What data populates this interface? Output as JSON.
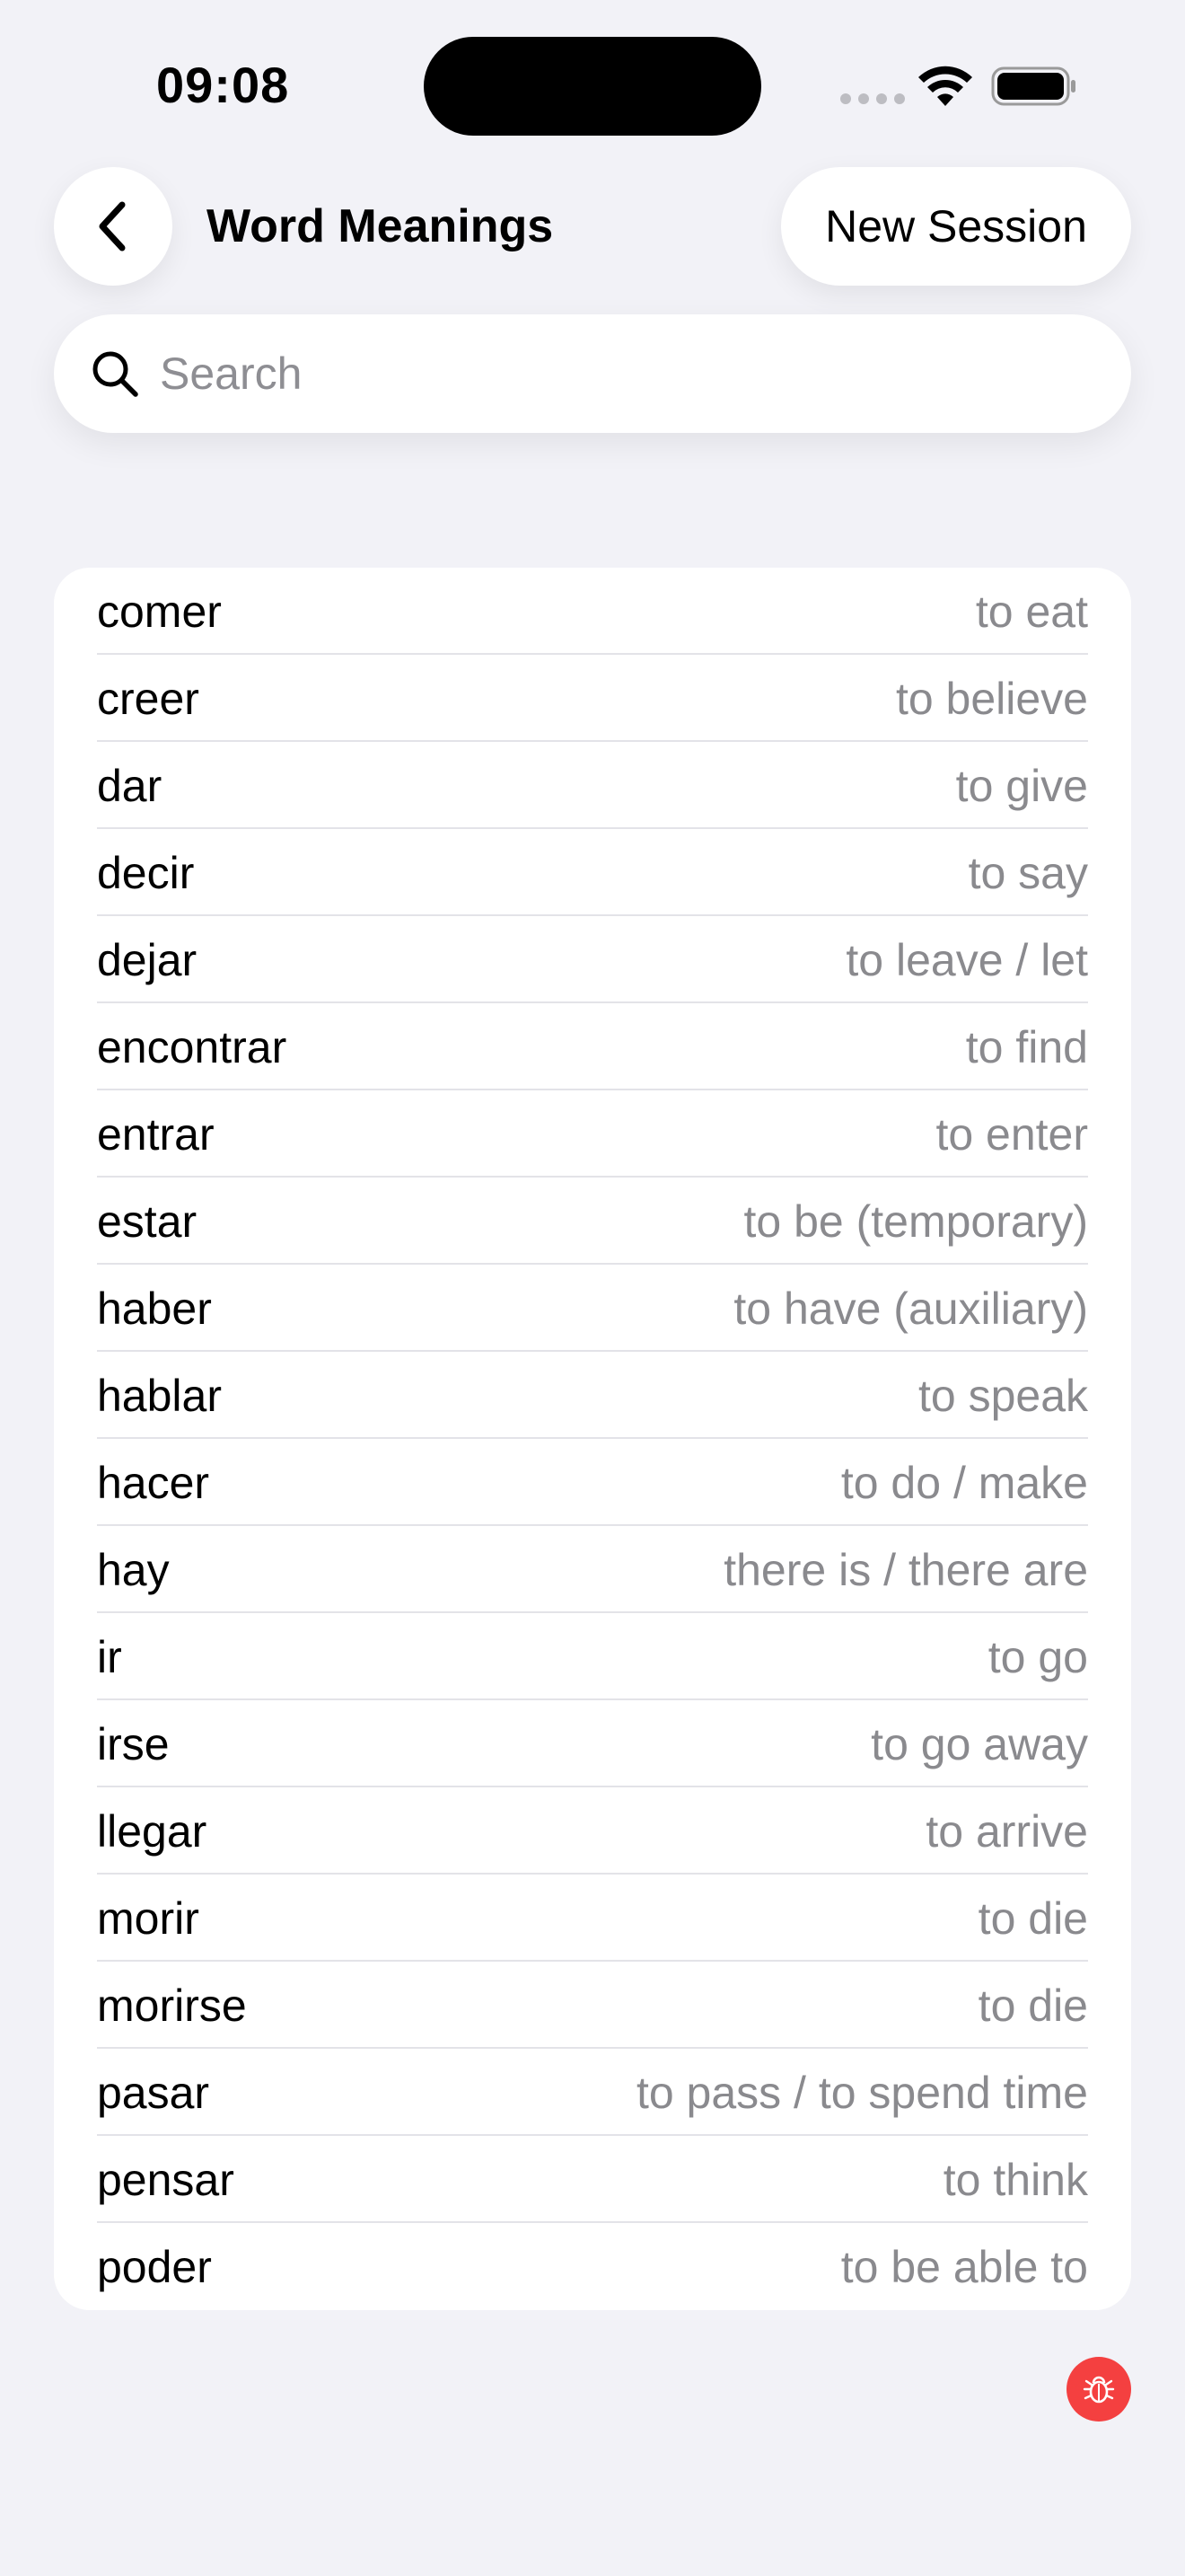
{
  "status_bar": {
    "time": "09:08"
  },
  "header": {
    "back_icon": "chevron-left-icon",
    "title": "Word Meanings",
    "new_session_label": "New Session"
  },
  "search": {
    "placeholder": "Search",
    "value": "",
    "icon": "search-icon"
  },
  "words": [
    {
      "word": "comer",
      "meaning": "to eat"
    },
    {
      "word": "creer",
      "meaning": "to believe"
    },
    {
      "word": "dar",
      "meaning": "to give"
    },
    {
      "word": "decir",
      "meaning": "to say"
    },
    {
      "word": "dejar",
      "meaning": "to leave / let"
    },
    {
      "word": "encontrar",
      "meaning": "to find"
    },
    {
      "word": "entrar",
      "meaning": "to enter"
    },
    {
      "word": "estar",
      "meaning": "to be (temporary)"
    },
    {
      "word": "haber",
      "meaning": "to have (auxiliary)"
    },
    {
      "word": "hablar",
      "meaning": "to speak"
    },
    {
      "word": "hacer",
      "meaning": "to do / make"
    },
    {
      "word": "hay",
      "meaning": "there is / there are"
    },
    {
      "word": "ir",
      "meaning": "to go"
    },
    {
      "word": "irse",
      "meaning": "to go away"
    },
    {
      "word": "llegar",
      "meaning": "to arrive"
    },
    {
      "word": "morir",
      "meaning": "to die"
    },
    {
      "word": "morirse",
      "meaning": "to die"
    },
    {
      "word": "pasar",
      "meaning": "to pass / to spend time"
    },
    {
      "word": "pensar",
      "meaning": "to think"
    },
    {
      "word": "poder",
      "meaning": "to be able to"
    }
  ],
  "debug": {
    "icon": "bug-icon",
    "color": "#f44040"
  },
  "colors": {
    "background": "#f2f2f7",
    "card": "#ffffff",
    "secondary_text": "#8a8a8e"
  }
}
